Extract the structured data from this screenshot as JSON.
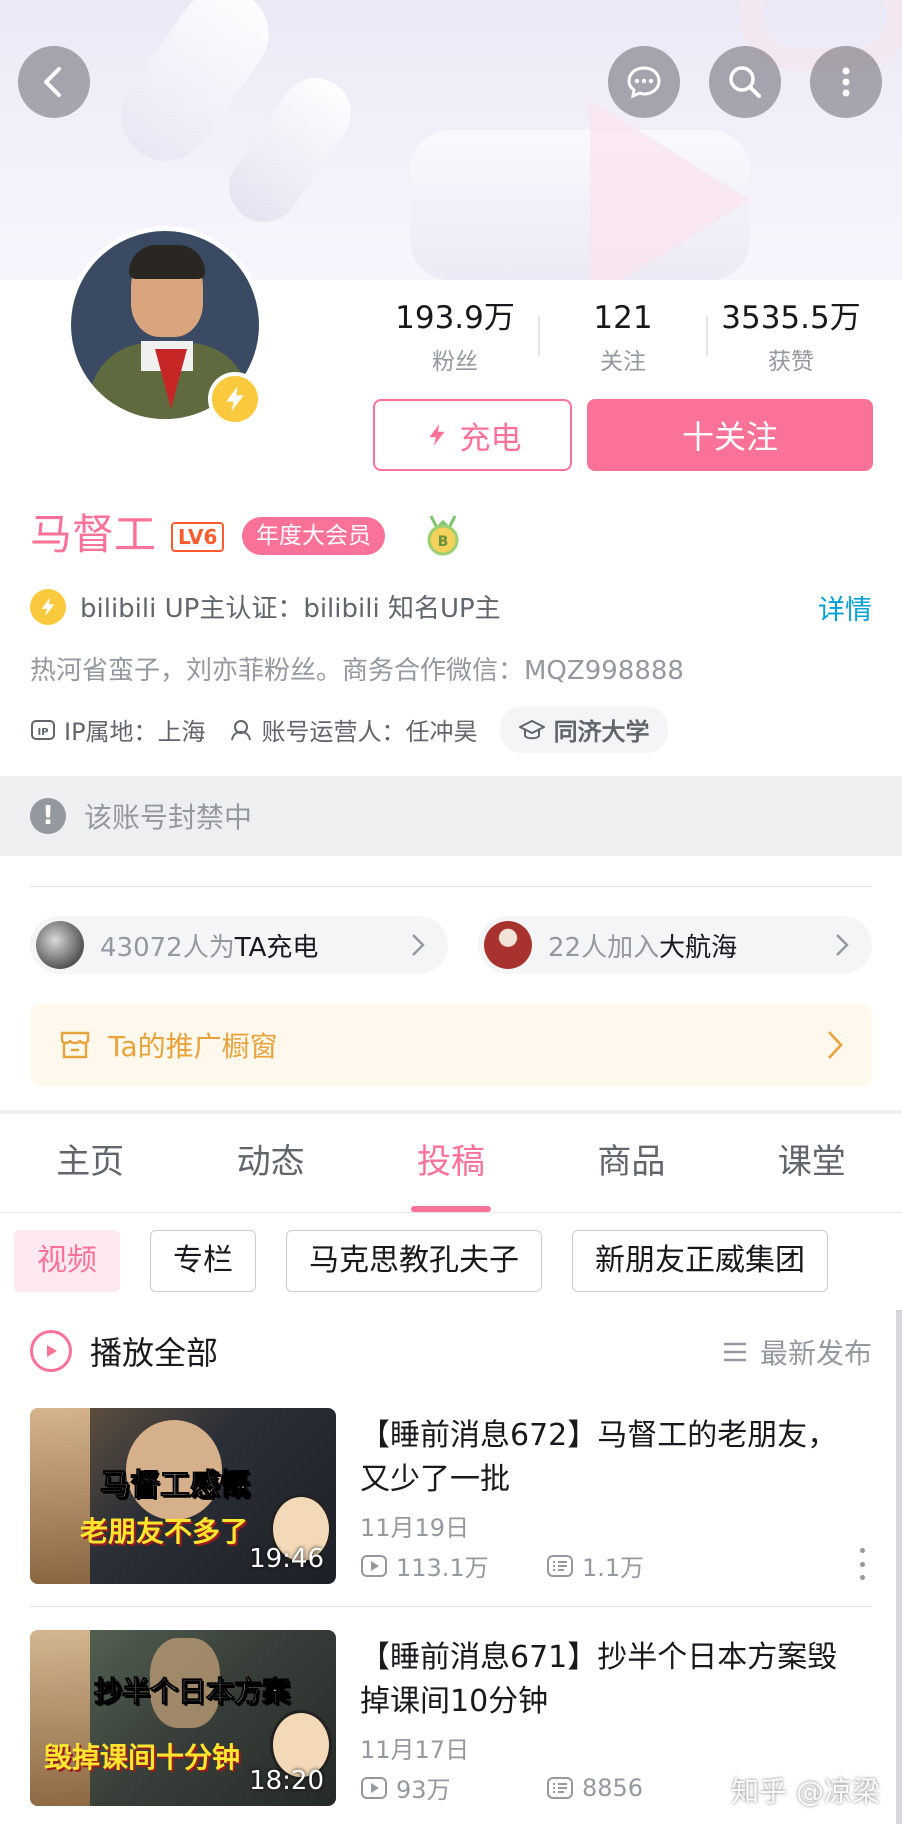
{
  "header": {
    "icons": [
      "back-icon",
      "message-icon",
      "search-icon",
      "more-icon"
    ]
  },
  "profile": {
    "stats": [
      {
        "value": "193.9万",
        "label": "粉丝"
      },
      {
        "value": "121",
        "label": "关注"
      },
      {
        "value": "3535.5万",
        "label": "获赞"
      }
    ],
    "charge_label": "充电",
    "follow_label": "十关注",
    "name": "马督工",
    "level": "LV6",
    "vip": "年度大会员",
    "auth": "bilibili UP主认证：bilibili 知名UP主",
    "detail": "详情",
    "sign": "热河省蛮子，刘亦菲粉丝。商务合作微信：MQZ998888",
    "ip": "IP属地：上海",
    "operator": "账号运营人：任冲昊",
    "school": "同济大学",
    "ban_notice": "该账号封禁中",
    "charge_pill": {
      "count": "43072人为",
      "hl": "TA充电"
    },
    "guard_pill": {
      "count": "22人加入",
      "hl": "大航海"
    },
    "shop": "Ta的推广橱窗"
  },
  "tabs": [
    {
      "label": "主页",
      "active": false
    },
    {
      "label": "动态",
      "active": false
    },
    {
      "label": "投稿",
      "active": true
    },
    {
      "label": "商品",
      "active": false
    },
    {
      "label": "课堂",
      "active": false
    }
  ],
  "chips": [
    "视频",
    "专栏",
    "马克思教孔夫子",
    "新朋友正威集团"
  ],
  "list": {
    "play_all": "播放全部",
    "sort": "最新发布"
  },
  "videos": [
    {
      "title": "【睡前消息672】马督工的老朋友，又少了一批",
      "date": "11月19日",
      "views": "113.1万",
      "danmaku": "1.1万",
      "duration": "19:46",
      "cap1": "马督工感慨",
      "cap2": "老朋友不多了"
    },
    {
      "title": "【睡前消息671】抄半个日本方案毁掉课间10分钟",
      "date": "11月17日",
      "views": "93万",
      "danmaku": "8856",
      "duration": "18:20",
      "cap1": "抄半个日本方案",
      "cap2": "毁掉课间十分钟"
    }
  ],
  "watermark": "知乎 @凉梁",
  "colors": {
    "accent": "#fb7299",
    "link": "#00a1d6",
    "gold": "#fbc93e"
  }
}
